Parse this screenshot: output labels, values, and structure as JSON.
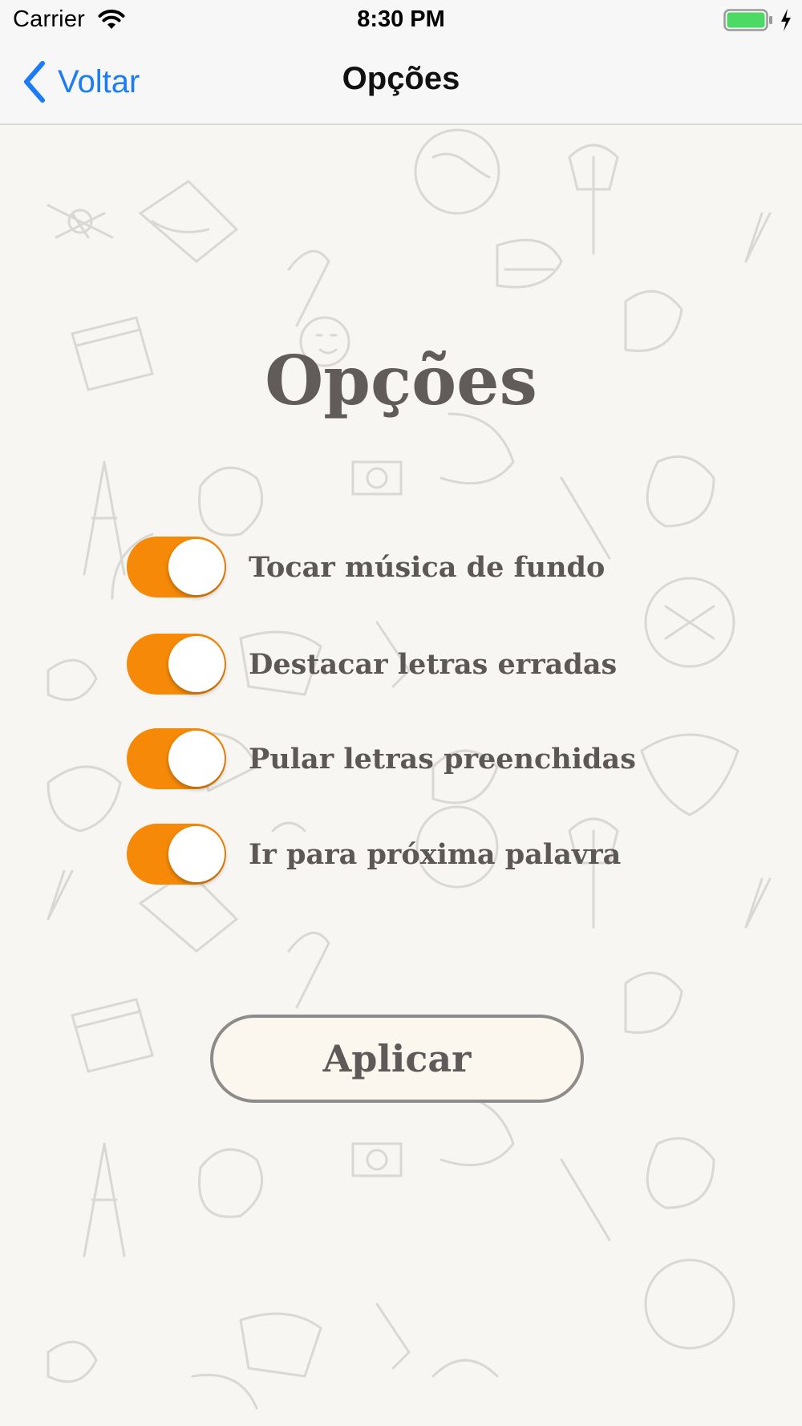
{
  "status_bar": {
    "carrier": "Carrier",
    "time": "8:30 PM",
    "wifi_icon": "wifi-icon",
    "battery_icon": "battery-full-icon",
    "charging_icon": "charging-bolt-icon"
  },
  "nav": {
    "back_label": "Voltar",
    "back_icon": "chevron-left-icon",
    "title": "Opções"
  },
  "main": {
    "heading": "Opções",
    "options": [
      {
        "label": "Tocar música de fundo",
        "enabled": true
      },
      {
        "label": "Destacar letras erradas",
        "enabled": true
      },
      {
        "label": "Pular letras preenchidas",
        "enabled": true
      },
      {
        "label": "Ir para próxima palavra",
        "enabled": true
      }
    ],
    "apply_label": "Aplicar"
  },
  "colors": {
    "toggle_on": "#f68a08",
    "link_blue": "#1b7cf5",
    "text_brown": "#5d5756",
    "background": "#f7f6f3"
  }
}
